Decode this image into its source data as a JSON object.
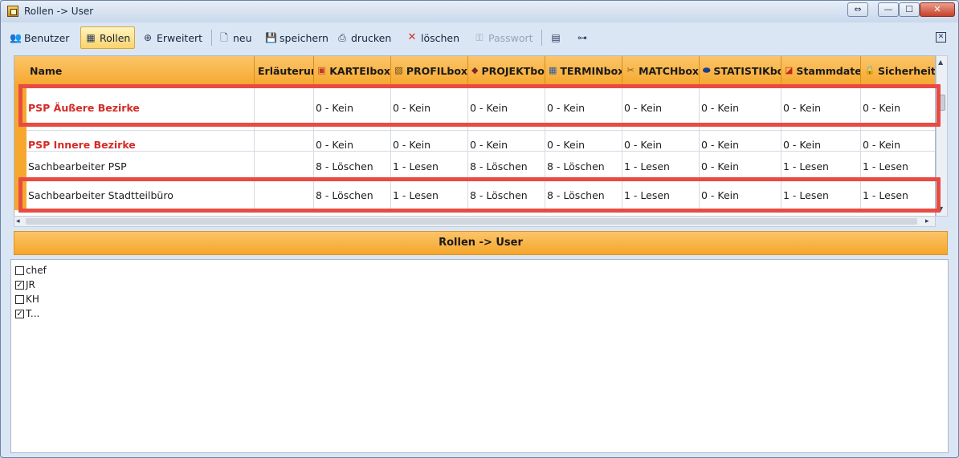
{
  "window": {
    "title": "Rollen -> User"
  },
  "title_buttons": {
    "restore": "⇔",
    "minimize": "—",
    "maximize": "☐",
    "close": "✕"
  },
  "toolbar": {
    "benutzer": "Benutzer",
    "rollen": "Rollen",
    "erweitert": "Erweitert",
    "neu": "neu",
    "speichern": "speichern",
    "drucken": "drucken",
    "loeschen": "löschen",
    "passwort": "Passwort",
    "close_pane": "✕"
  },
  "grid": {
    "columns": [
      "Name",
      "Erläuterung",
      "KARTEIbox",
      "PROFILbox",
      "PROJEKTbox",
      "TERMINbox",
      "MATCHbox",
      "STATISTIKbox",
      "Stammdaten",
      "Sicherheit"
    ],
    "rows": [
      {
        "cells": [
          "PSP Äußere Bezirke",
          "",
          "0 - Kein",
          "0 - Kein",
          "0 - Kein",
          "0 - Kein",
          "0 - Kein",
          "0 - Kein",
          "0 - Kein",
          "0 - Kein"
        ]
      },
      {
        "cells": [
          "PSP Innere Bezirke",
          "",
          "0 - Kein",
          "0 - Kein",
          "0 - Kein",
          "0 - Kein",
          "0 - Kein",
          "0 - Kein",
          "0 - Kein",
          "0 - Kein"
        ]
      },
      {
        "cells": [
          "Sachbearbeiter PSP",
          "",
          "8 - Löschen",
          "1 - Lesen",
          "8 - Löschen",
          "8 - Löschen",
          "1 - Lesen",
          "0 - Kein",
          "1 - Lesen",
          "1 - Lesen"
        ]
      },
      {
        "cells": [
          "Sachbearbeiter Stadtteilbüro",
          "",
          "8 - Löschen",
          "1 - Lesen",
          "8 - Löschen",
          "8 - Löschen",
          "1 - Lesen",
          "0 - Kein",
          "1 - Lesen",
          "1 - Lesen"
        ]
      }
    ]
  },
  "section": {
    "title": "Rollen -> User"
  },
  "users": [
    {
      "name": "chef",
      "checked": false
    },
    {
      "name": "JR",
      "checked": true
    },
    {
      "name": "KH",
      "checked": false
    },
    {
      "name": "T...",
      "checked": true
    }
  ],
  "colors": {
    "accent_orange": "#f6a82e",
    "highlight_red": "#e84b43",
    "role_red": "#d42b27"
  }
}
